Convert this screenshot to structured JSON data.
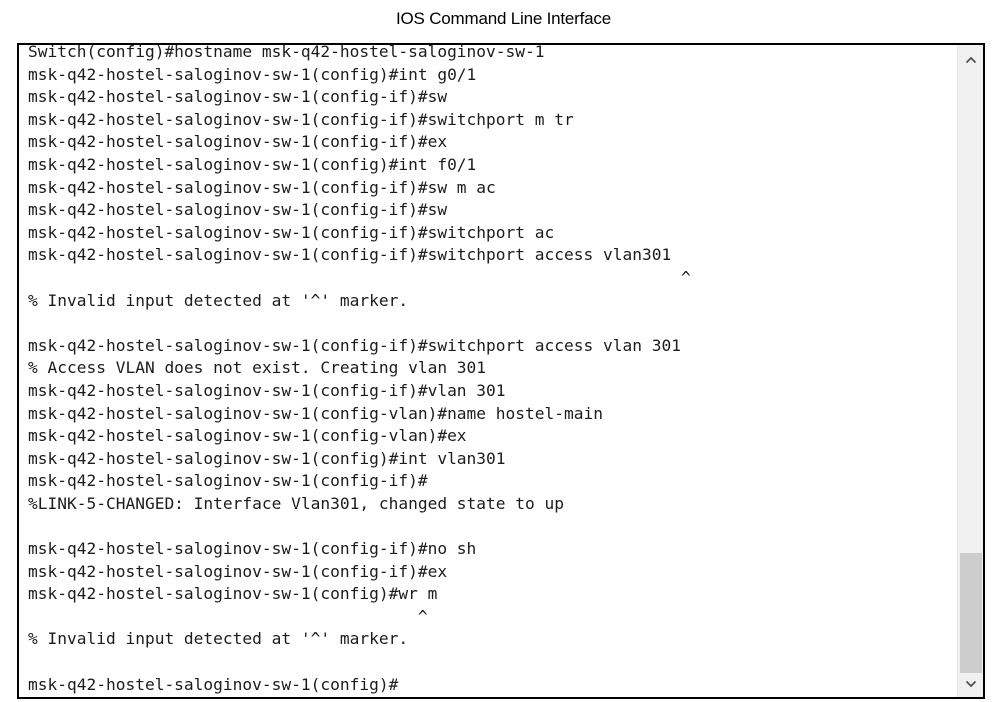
{
  "window": {
    "title": "IOS Command Line Interface"
  },
  "terminal": {
    "lines": [
      "Switch(config)#hostname msk-q42-hostel-saloginov-sw-1",
      "msk-q42-hostel-saloginov-sw-1(config)#int g0/1",
      "msk-q42-hostel-saloginov-sw-1(config-if)#sw",
      "msk-q42-hostel-saloginov-sw-1(config-if)#switchport m tr",
      "msk-q42-hostel-saloginov-sw-1(config-if)#ex",
      "msk-q42-hostel-saloginov-sw-1(config)#int f0/1",
      "msk-q42-hostel-saloginov-sw-1(config-if)#sw m ac",
      "msk-q42-hostel-saloginov-sw-1(config-if)#sw",
      "msk-q42-hostel-saloginov-sw-1(config-if)#switchport ac",
      "msk-q42-hostel-saloginov-sw-1(config-if)#switchport access vlan301",
      "                                                                   ^",
      "% Invalid input detected at '^' marker.",
      "",
      "msk-q42-hostel-saloginov-sw-1(config-if)#switchport access vlan 301",
      "% Access VLAN does not exist. Creating vlan 301",
      "msk-q42-hostel-saloginov-sw-1(config-if)#vlan 301",
      "msk-q42-hostel-saloginov-sw-1(config-vlan)#name hostel-main",
      "msk-q42-hostel-saloginov-sw-1(config-vlan)#ex",
      "msk-q42-hostel-saloginov-sw-1(config)#int vlan301",
      "msk-q42-hostel-saloginov-sw-1(config-if)#",
      "%LINK-5-CHANGED: Interface Vlan301, changed state to up",
      "",
      "msk-q42-hostel-saloginov-sw-1(config-if)#no sh",
      "msk-q42-hostel-saloginov-sw-1(config-if)#ex",
      "msk-q42-hostel-saloginov-sw-1(config)#wr m",
      "                                        ^",
      "% Invalid input detected at '^' marker.",
      "",
      "msk-q42-hostel-saloginov-sw-1(config)#"
    ]
  },
  "scrollbar": {
    "up_icon": "chevron-up-icon",
    "down_icon": "chevron-down-icon"
  },
  "colors": {
    "text": "#1c1c1c",
    "border": "#000000",
    "scrollbar_track": "#f0f0f0",
    "scrollbar_thumb": "#cdcdcd"
  }
}
